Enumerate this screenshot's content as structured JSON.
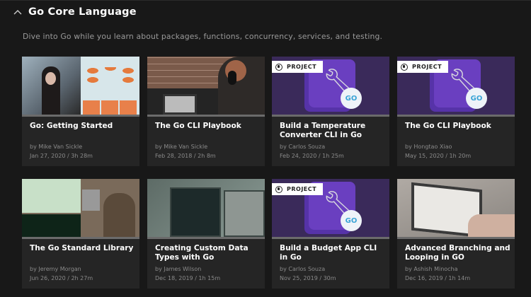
{
  "section": {
    "title": "Go Core Language",
    "description": "Dive into Go while you learn about packages, functions, concurrency, services, and testing.",
    "collapse_icon": "chevron-up-icon"
  },
  "badge_label": "PROJECT",
  "courses": [
    {
      "title": "Go: Getting Started",
      "author": "by Mike Van Sickle",
      "meta": "Jan 27, 2020 / 3h 28m",
      "project": false,
      "thumb": "person-slide"
    },
    {
      "title": "The Go CLI Playbook",
      "author": "by Mike Van Sickle",
      "meta": "Feb 28, 2018 / 2h 8m",
      "project": false,
      "thumb": "headphones"
    },
    {
      "title": "Build a Temperature Converter CLI in Go",
      "author": "by Carlos Souza",
      "meta": "Feb 24, 2020 / 1h 25m",
      "project": true,
      "thumb": "project"
    },
    {
      "title": "The Go CLI Playbook",
      "author": "by Hongtao Xiao",
      "meta": "May 15, 2020 / 1h 20m",
      "project": true,
      "thumb": "project"
    },
    {
      "title": "The Go Standard Library",
      "author": "by Jeremy Morgan",
      "meta": "Jun 26, 2020 / 2h 27m",
      "project": false,
      "thumb": "code-desk"
    },
    {
      "title": "Creating Custom Data Types with Go",
      "author": "by James Wilson",
      "meta": "Dec 18, 2019 / 1h 15m",
      "project": false,
      "thumb": "monitors"
    },
    {
      "title": "Build a Budget App CLI in Go",
      "author": "by Carlos Souza",
      "meta": "Nov 25, 2019 / 30m",
      "project": true,
      "thumb": "project"
    },
    {
      "title": "Advanced Branching and Looping in GO",
      "author": "by Ashish Minocha",
      "meta": "Dec 16, 2019 / 1h 14m",
      "project": false,
      "thumb": "laptop"
    }
  ],
  "colors": {
    "background": "#181818",
    "card": "#252525",
    "project_purple": "#3a2a5a"
  }
}
